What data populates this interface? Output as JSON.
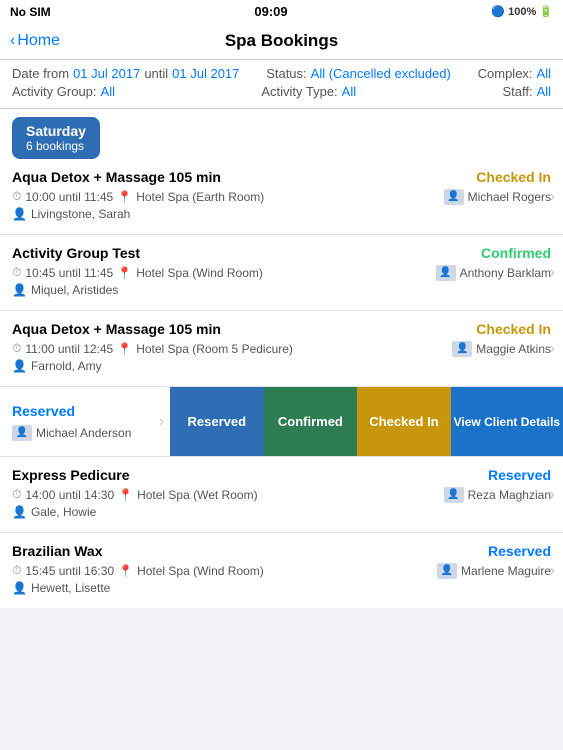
{
  "statusBar": {
    "carrier": "No SIM",
    "wifi": "📶",
    "time": "09:09",
    "bluetooth": "🔵",
    "battery": "100%"
  },
  "navBar": {
    "backLabel": "Home",
    "title": "Spa Bookings"
  },
  "filters": {
    "dateFromLabel": "Date from",
    "dateFrom": "01 Jul 2017",
    "untilLabel": "until",
    "dateTo": "01 Jul 2017",
    "statusLabel": "Status:",
    "statusValue": "All (Cancelled excluded)",
    "complexLabel": "Complex:",
    "complexValue": "All",
    "activityGroupLabel": "Activity Group:",
    "activityGroupValue": "All",
    "activityTypeLabel": "Activity Type:",
    "activityTypeValue": "All",
    "staffLabel": "Staff:",
    "staffValue": "All"
  },
  "selectedDay": {
    "dayName": "Saturday",
    "bookingsCount": "6 bookings"
  },
  "bookings": [
    {
      "id": "b1",
      "title": "Aqua Detox + Massage 105 min",
      "time": "10:00 until 11:45",
      "location": "Hotel Spa (Earth Room)",
      "client": "Livingstone, Sarah",
      "status": "Checked In",
      "statusType": "checked-in",
      "staff": "Michael Rogers"
    },
    {
      "id": "b2",
      "title": "Activity Group Test",
      "time": "10:45 until 11:45",
      "location": "Hotel Spa (Wind Room)",
      "client": "Miquel, Aristides",
      "status": "Confirmed",
      "statusType": "confirmed",
      "staff": "Anthony Barklam"
    },
    {
      "id": "b3",
      "title": "Aqua Detox + Massage 105 min",
      "time": "11:00 until 12:45",
      "location": "Hotel Spa (Room 5 Pedicure)",
      "client": "Farnold, Amy",
      "status": "Checked In",
      "statusType": "checked-in",
      "staff": "Maggie Atkins"
    },
    {
      "id": "b4-swipe",
      "title": null,
      "time": null,
      "location": null,
      "client": "Michael Anderson",
      "status": "Reserved",
      "statusType": "reserved",
      "staff": null,
      "isSwipeOpen": true,
      "swipeActions": [
        "Reserved",
        "Confirmed",
        "Checked In",
        "View Client Details"
      ]
    },
    {
      "id": "b5",
      "title": "Express Pedicure",
      "time": "14:00 until 14:30",
      "location": "Hotel Spa (Wet Room)",
      "client": "Gale, Howie",
      "status": "Reserved",
      "statusType": "reserved",
      "staff": "Reza Maghzian"
    },
    {
      "id": "b6",
      "title": "Brazilian Wax",
      "time": "15:45 until 16:30",
      "location": "Hotel Spa (Wind Room)",
      "client": "Hewett, Lisette",
      "status": "Reserved",
      "statusType": "reserved",
      "staff": "Marlene Maguire"
    }
  ]
}
